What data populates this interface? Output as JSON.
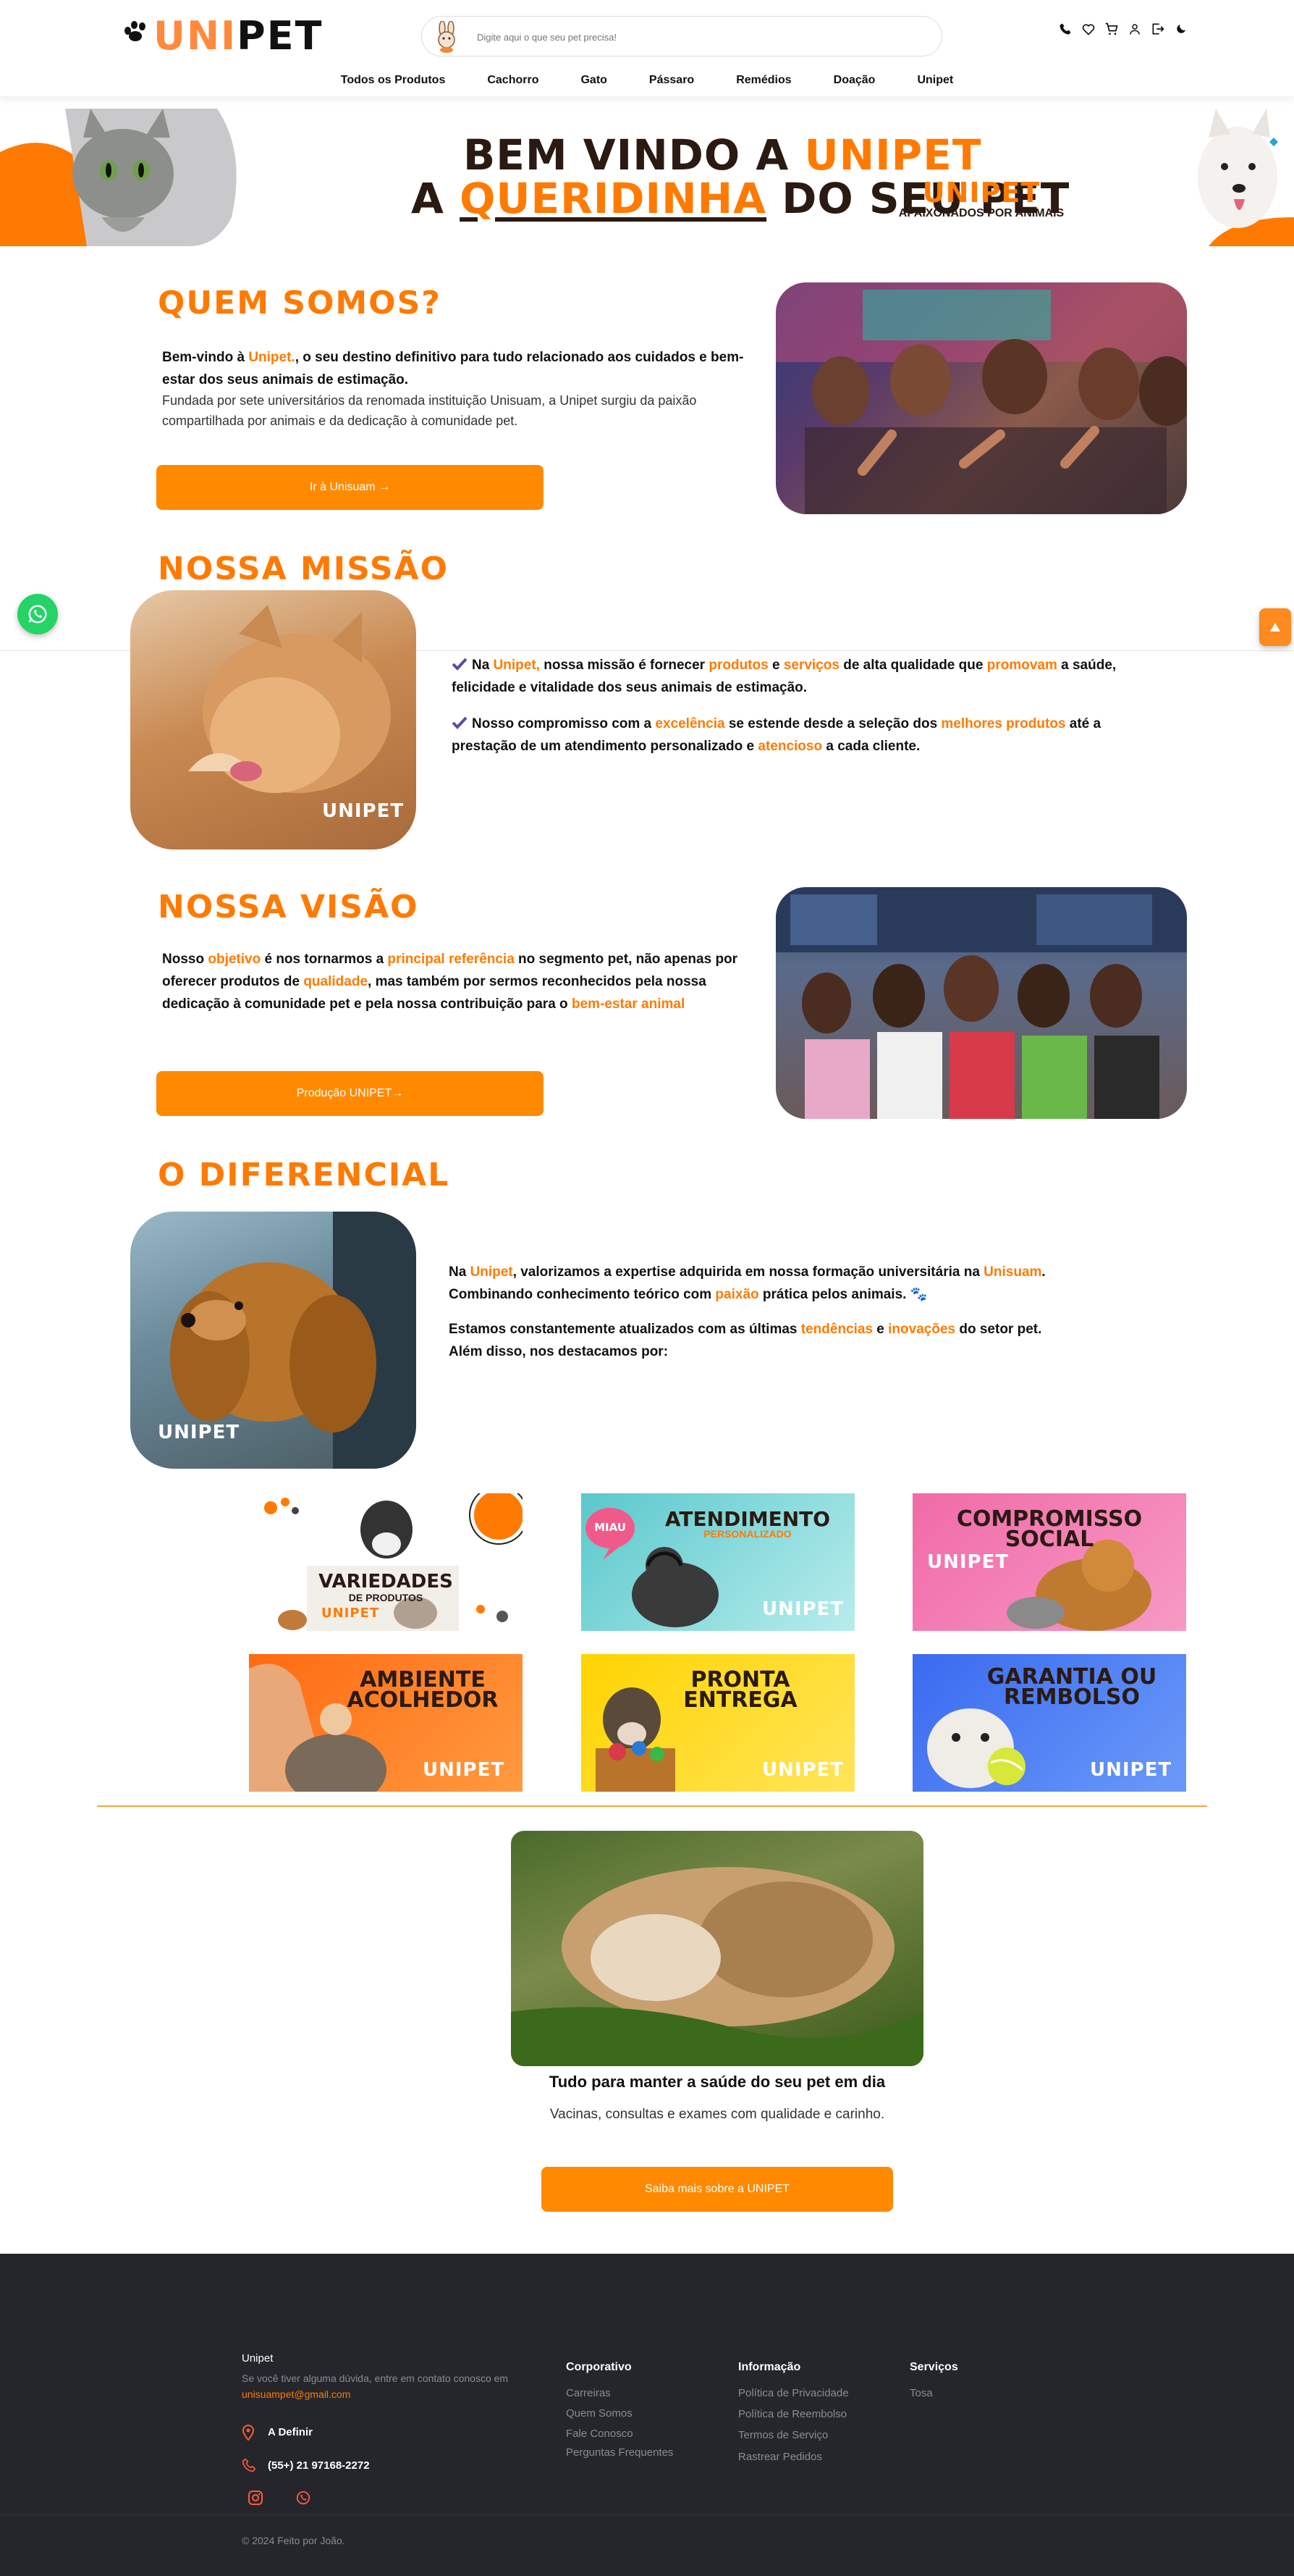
{
  "header": {
    "logo_part1": "UNI",
    "logo_part2": "PET",
    "search_placeholder": "Digite aqui o que seu pet precisa!",
    "nav": [
      "Todos os Produtos",
      "Cachorro",
      "Gato",
      "Pássaro",
      "Remédios",
      "Doação",
      "Unipet"
    ],
    "icons": [
      "phone-icon",
      "heart-icon",
      "cart-icon",
      "user-icon",
      "logout-icon",
      "moon-icon"
    ]
  },
  "banner": {
    "line1_a": "BEM VINDO A ",
    "line1_b": "UNIPET",
    "line2_a": "A ",
    "line2_b": "QUERIDINHA",
    "line2_c": " DO SEU PET",
    "badge_brand": "UNIPET",
    "badge_tagline": "APAIXONADOS POR ANIMAIS"
  },
  "about": {
    "title": "QUEM SOMOS?",
    "p1_a": "Bem-vindo à ",
    "p1_b": "Unipet.",
    "p1_c": ", o seu destino definitivo para tudo relacionado aos cuidados e bem-estar dos seus animais de estimação.",
    "p2": "Fundada por sete universitários da renomada instituição Unisuam, a Unipet surgiu da paixão compartilhada por animais e da dedicação à comunidade pet.",
    "button": "Ir à Unisuam →"
  },
  "mission": {
    "title": "NOSSA MISSÃO",
    "item1": [
      "Na ",
      "Unipet,",
      " nossa missão é fornecer ",
      "produtos",
      " e ",
      "serviços",
      " de alta qualidade que ",
      "promovam",
      " a saúde, felicidade e vitalidade dos seus animais de estimação."
    ],
    "item2": [
      "Nosso compromisso com a ",
      "excelência",
      " se estende desde a seleção dos ",
      "melhores produtos",
      " até a prestação de um atendimento personalizado e ",
      "atencioso",
      " a cada cliente."
    ],
    "photo_brand": "UNIPET"
  },
  "vision": {
    "title": "NOSSA VISÃO",
    "text": [
      "Nosso ",
      "objetivo",
      " é nos tornarmos a ",
      "principal referência",
      " no segmento pet, não apenas por oferecer produtos de ",
      "qualidade",
      ", mas também por sermos reconhecidos pela nossa dedicação à comunidade pet e pela nossa contribuição para o ",
      "bem-estar animal"
    ],
    "button": "Produção UNIPET→"
  },
  "differential": {
    "title": "O DIFERENCIAL",
    "p1": [
      "Na ",
      "Unipet",
      ", valorizamos a expertise adquirida em nossa formação universitária na ",
      "Unisuam",
      ". Combinando conhecimento teórico com ",
      "paixão",
      " prática pelos animais. 🐾"
    ],
    "p2": [
      "Estamos constantemente atualizados com as últimas ",
      "tendências",
      " e ",
      "inovações",
      " do setor pet. Além disso, nos destacamos por:"
    ],
    "photo_brand": "UNIPET"
  },
  "features": [
    {
      "title": "VARIEDADES",
      "sub": "DE PRODUTOS",
      "brand": "UNIPET",
      "bg": "#ffffff"
    },
    {
      "title": "ATENDIMENTO",
      "sub": "PERSONALIZADO",
      "brand": "UNIPET",
      "bg": "#7fd6d8",
      "bubble": "MIAU"
    },
    {
      "title": "COMPROMISSO SOCIAL",
      "sub": "",
      "brand": "UNIPET",
      "bg": "#f57bb0"
    },
    {
      "title": "AMBIENTE ACOLHEDOR",
      "sub": "",
      "brand": "UNIPET",
      "bg": "#ff7e1f"
    },
    {
      "title": "PRONTA ENTREGA",
      "sub": "",
      "brand": "UNIPET",
      "bg": "#ffd913"
    },
    {
      "title": "GARANTIA OU REMBOLSO",
      "sub": "",
      "brand": "UNIPET",
      "bg": "#4e86f5"
    }
  ],
  "health": {
    "title": "Tudo para manter a saúde do seu pet em dia",
    "subtitle": "Vacinas, consultas e exames com qualidade e carinho.",
    "button": "Saiba mais sobre a UNIPET"
  },
  "footer": {
    "brand": "Unipet",
    "contact_text": "Se você tiver alguma dúvida, entre em contato conosco em",
    "email": "unisuampet@gmail.com",
    "address": "A Definir",
    "phone": "(55+) 21 97168-2272",
    "columns": [
      {
        "title": "Corporativo",
        "links": [
          "Carreiras",
          "Quem Somos",
          "Fale Conosco",
          "Perguntas Frequentes"
        ]
      },
      {
        "title": "Informação",
        "links": [
          "Política de Privacidade",
          "Política de Reembolso",
          "Termos de Serviço",
          "Rastrear Pedidos"
        ]
      },
      {
        "title": "Serviços",
        "links": [
          "Tosa"
        ]
      }
    ],
    "copyright": "© 2024 Feito por João."
  },
  "colors": {
    "accent": "#ff7a00",
    "dark": "#25262b",
    "whatsapp": "#25d366"
  }
}
